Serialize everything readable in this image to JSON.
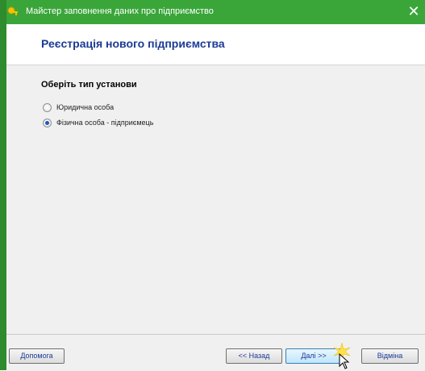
{
  "window": {
    "title": "Майстер заповнення даних про підприємство",
    "close_symbol": "✕"
  },
  "header": {
    "title": "Реєстрація нового підприємства"
  },
  "content": {
    "group_label": "Оберіть тип установи",
    "options": [
      {
        "label": "Юридична особа",
        "checked": false
      },
      {
        "label": "Фізична особа - підприємець",
        "checked": true
      }
    ]
  },
  "buttons": {
    "help": "Допомога",
    "back": "<< Назад",
    "next": "Далі >>",
    "cancel": "Відміна"
  },
  "icons": {
    "app": "app-key-icon",
    "close": "close-icon",
    "cursor": "mouse-cursor-icon",
    "highlight": "click-highlight-icon"
  },
  "colors": {
    "titlebar": "#3aa63a",
    "header_title": "#1c3a96",
    "radio_selected": "#1c57c8"
  }
}
